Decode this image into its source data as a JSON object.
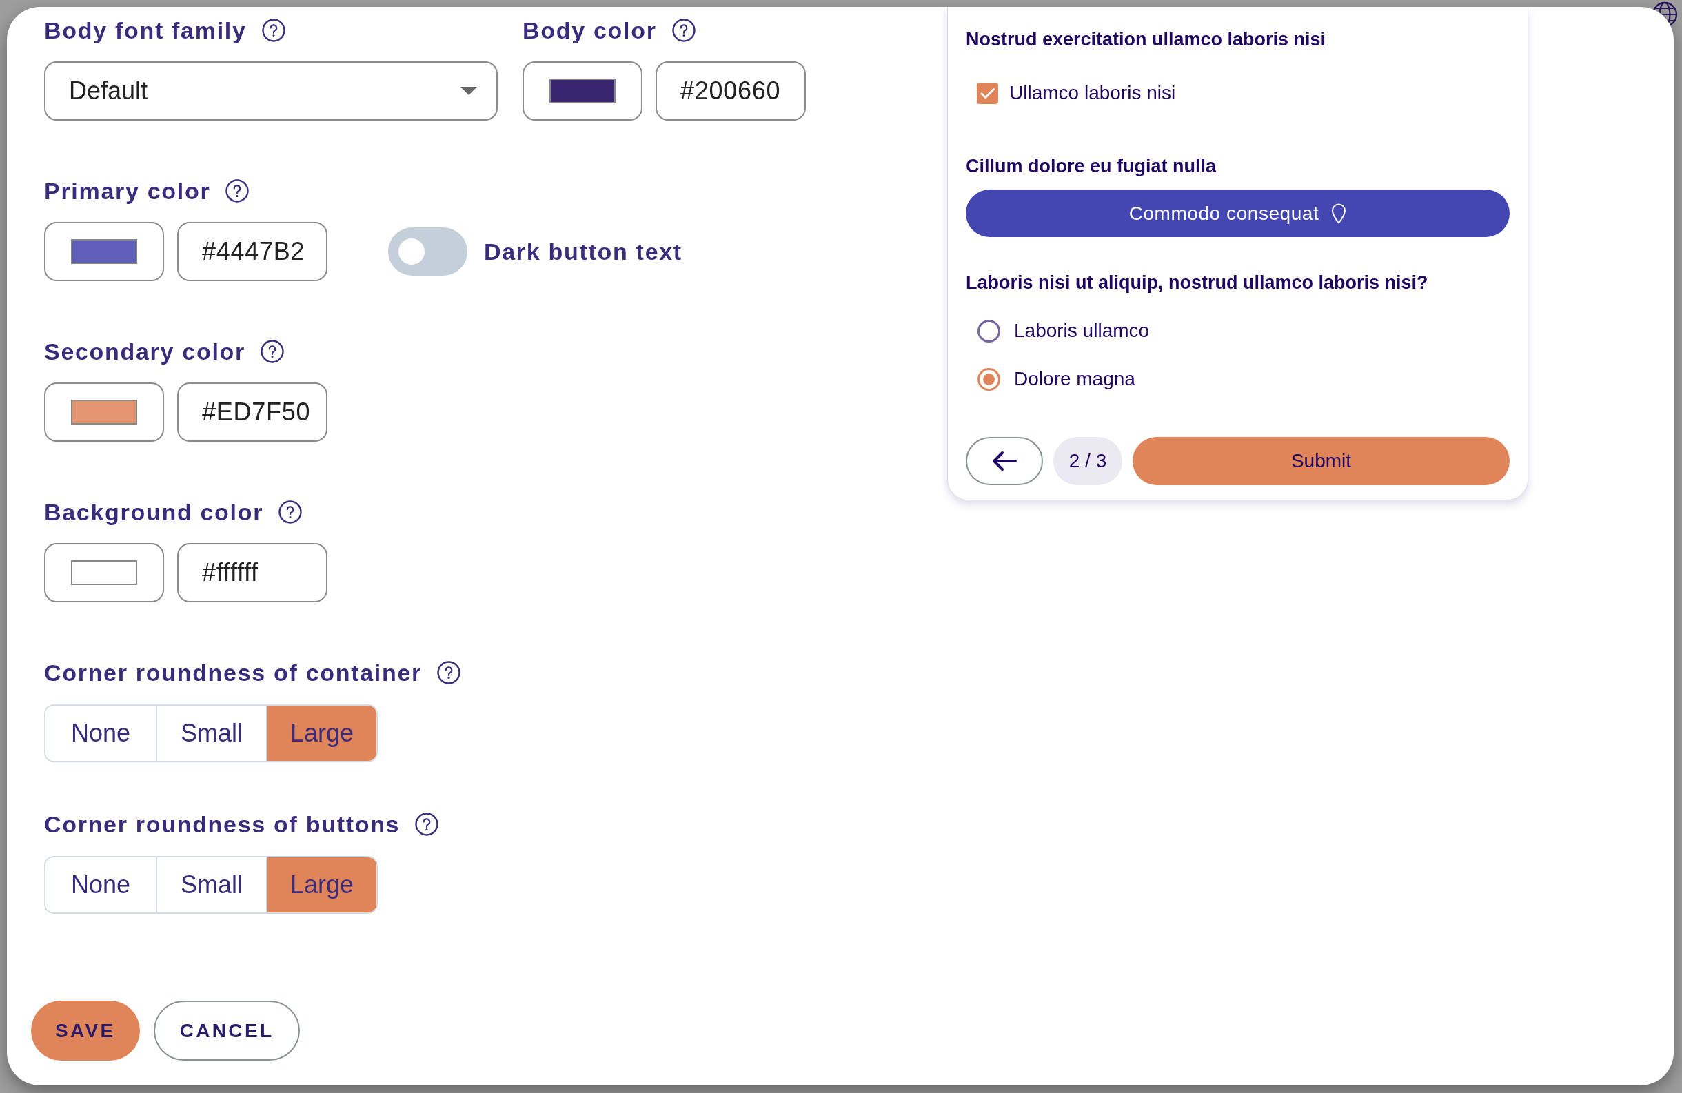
{
  "settings": {
    "rows": [
      [
        {
          "kind": "select",
          "label": "Body font family",
          "value": "Default"
        },
        {
          "kind": "color",
          "label": "Body color",
          "value": "#200660",
          "color": "#3a2670"
        }
      ],
      [
        {
          "kind": "color",
          "label": "Primary color",
          "value": "#4447B2",
          "color": "#5d5fb9"
        },
        {
          "kind": "toggle",
          "label": "Dark button text",
          "on": false
        }
      ],
      [
        {
          "kind": "color",
          "label": "Secondary color",
          "value": "#ED7F50",
          "color": "#e39572"
        }
      ],
      [
        {
          "kind": "color",
          "label": "Background color",
          "value": "#ffffff",
          "color": "#ffffff"
        }
      ],
      [
        {
          "kind": "segmented",
          "label": "Corner roundness of container",
          "options": [
            {
              "label": "None",
              "selected": false
            },
            {
              "label": "Small",
              "selected": false
            },
            {
              "label": "Large",
              "selected": true
            }
          ]
        }
      ],
      [
        {
          "kind": "segmented",
          "label": "Corner roundness of buttons",
          "options": [
            {
              "label": "None",
              "selected": false
            },
            {
              "label": "Small",
              "selected": false
            },
            {
              "label": "Large",
              "selected": true
            }
          ]
        }
      ]
    ],
    "actions": [
      {
        "kind": "primary",
        "label": "SAVE"
      },
      {
        "kind": "secondary",
        "label": "CANCEL"
      }
    ]
  },
  "preview": {
    "sections": [
      {
        "kind": "checkboxes",
        "heading": "Nostrud exercitation ullamco laboris nisi",
        "options": [
          {
            "label": "Ullamco laboris nisi",
            "checked": true
          }
        ]
      },
      {
        "kind": "button",
        "heading": "Cillum dolore eu fugiat nulla",
        "button": "Commodo consequat"
      },
      {
        "kind": "radios",
        "heading": "Laboris nisi ut aliquip, nostrud ullamco laboris nisi?",
        "options": [
          {
            "label": "Laboris ullamco",
            "selected": false
          },
          {
            "label": "Dolore magna",
            "selected": true
          }
        ]
      }
    ],
    "footer": {
      "page": "2 / 3",
      "submit": "Submit"
    }
  }
}
